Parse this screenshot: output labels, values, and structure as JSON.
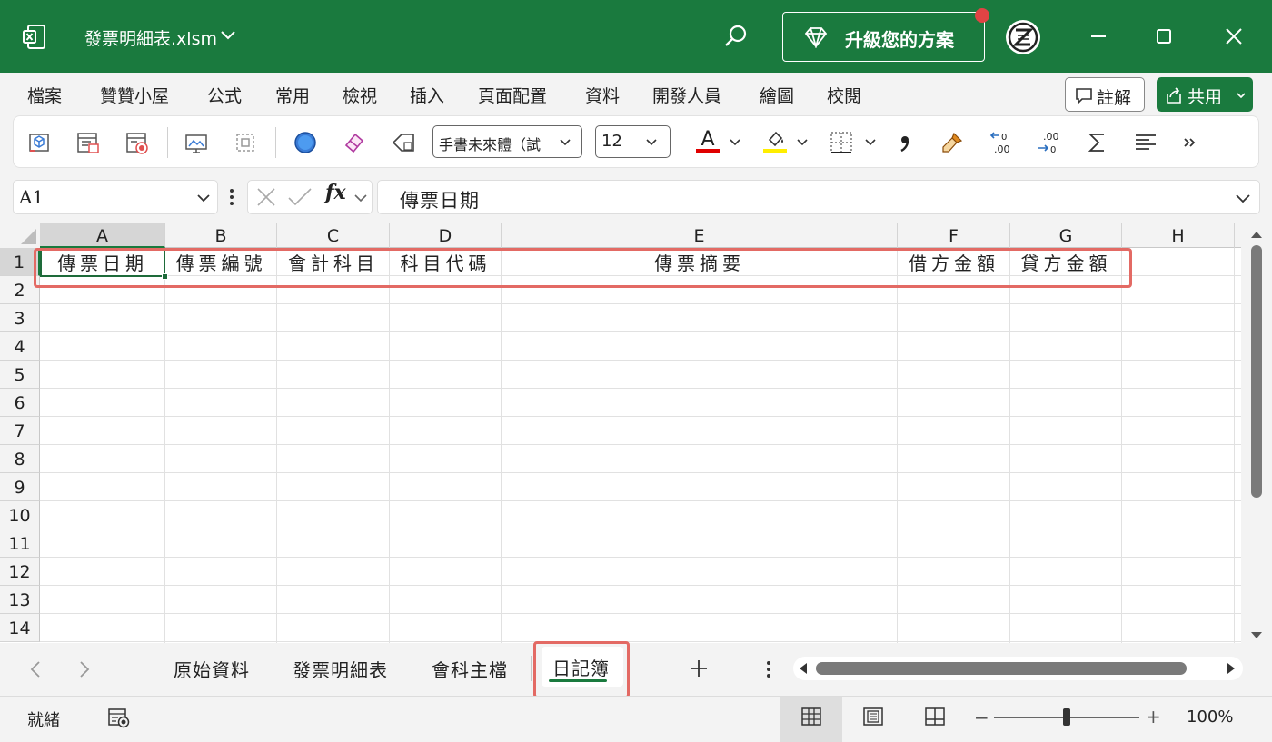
{
  "titlebar": {
    "filename": "發票明細表.xlsm",
    "upgrade_label": "升級您的方案",
    "accent": "#1a7a3e"
  },
  "menu": {
    "items": [
      "檔案",
      "贊贊小屋",
      "公式",
      "常用",
      "檢視",
      "插入",
      "頁面配置",
      "資料",
      "開發人員",
      "繪圖",
      "校閱"
    ],
    "comment_label": "註解",
    "share_label": "共用"
  },
  "ribbon": {
    "font_name": "手書未來體（試",
    "font_size": "12",
    "font_color": "#e00000",
    "highlight_color": "#ffee00"
  },
  "formula_bar": {
    "name_box": "A1",
    "fx_label": "fx",
    "content": "傳票日期"
  },
  "grid": {
    "columns": [
      "A",
      "B",
      "C",
      "D",
      "E",
      "F",
      "G",
      "H"
    ],
    "rows": [
      "1",
      "2",
      "3",
      "4",
      "5",
      "6",
      "7",
      "8",
      "9",
      "10",
      "11",
      "12",
      "13",
      "14"
    ],
    "row1": [
      "傳票日期",
      "傳票編號",
      "會計科目",
      "科目代碼",
      "傳票摘要",
      "借方金額",
      "貸方金額",
      ""
    ]
  },
  "sheets": {
    "tabs": [
      "原始資料",
      "發票明細表",
      "會科主檔"
    ],
    "active": "日記簿"
  },
  "status": {
    "ready": "就緒",
    "zoom": "100%"
  },
  "highlight_color": "#e36a64"
}
